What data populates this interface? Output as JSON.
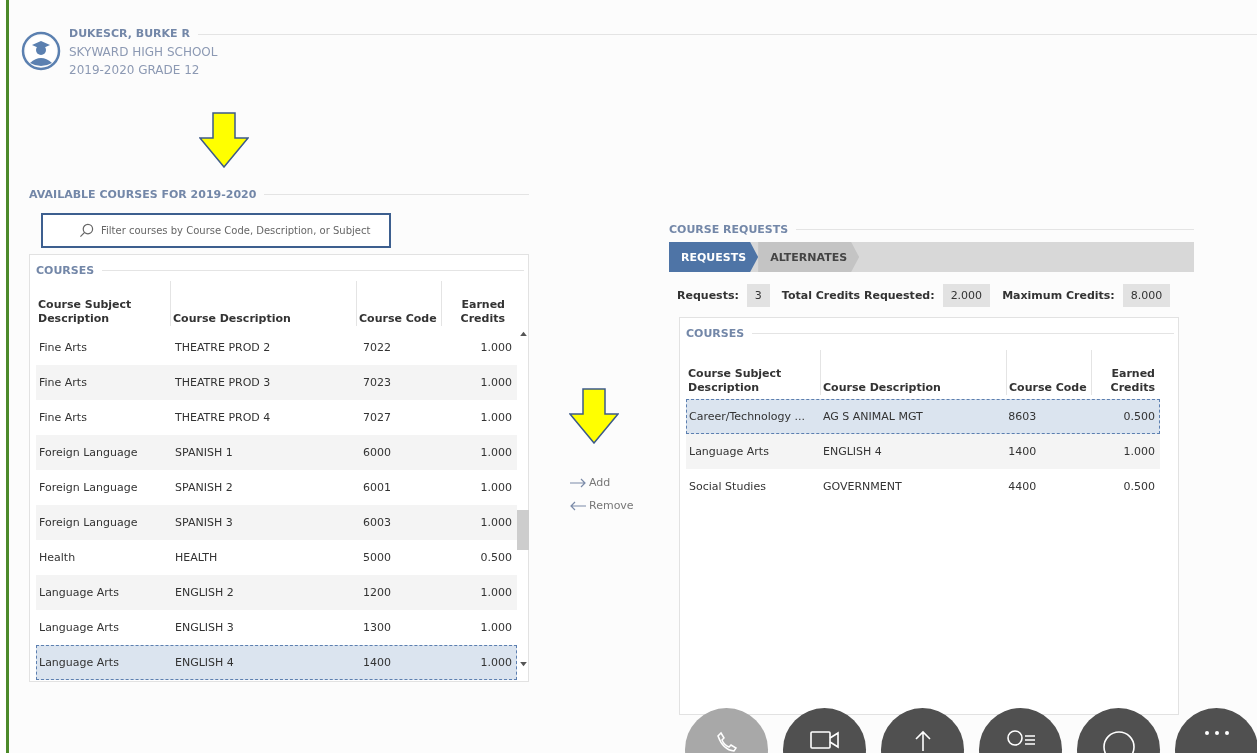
{
  "student": {
    "name": "DUKESCR, BURKE R",
    "school": "SKYWARD HIGH SCHOOL",
    "year_grade": "2019-2020 GRADE 12"
  },
  "available": {
    "title": "AVAILABLE COURSES FOR 2019-2020",
    "search": {
      "placeholder": "Filter courses by Course Code, Description, or Subject"
    },
    "section": "COURSES",
    "columns": [
      "Course Subject Description",
      "Course Description",
      "Course Code",
      "Earned Credits"
    ],
    "rows": [
      {
        "subject": "Fine Arts",
        "description": "THEATRE PROD 2",
        "code": "7022",
        "credits": "1.000",
        "selected": false
      },
      {
        "subject": "Fine Arts",
        "description": "THEATRE PROD 3",
        "code": "7023",
        "credits": "1.000",
        "selected": false
      },
      {
        "subject": "Fine Arts",
        "description": "THEATRE PROD 4",
        "code": "7027",
        "credits": "1.000",
        "selected": false
      },
      {
        "subject": "Foreign Language",
        "description": "SPANISH 1",
        "code": "6000",
        "credits": "1.000",
        "selected": false
      },
      {
        "subject": "Foreign Language",
        "description": "SPANISH 2",
        "code": "6001",
        "credits": "1.000",
        "selected": false
      },
      {
        "subject": "Foreign Language",
        "description": "SPANISH 3",
        "code": "6003",
        "credits": "1.000",
        "selected": false
      },
      {
        "subject": "Health",
        "description": "HEALTH",
        "code": "5000",
        "credits": "0.500",
        "selected": false
      },
      {
        "subject": "Language Arts",
        "description": "ENGLISH 2",
        "code": "1200",
        "credits": "1.000",
        "selected": false
      },
      {
        "subject": "Language Arts",
        "description": "ENGLISH 3",
        "code": "1300",
        "credits": "1.000",
        "selected": false
      },
      {
        "subject": "Language Arts",
        "description": "ENGLISH 4",
        "code": "1400",
        "credits": "1.000",
        "selected": true
      }
    ]
  },
  "actions": {
    "add": "Add",
    "remove": "Remove"
  },
  "requests": {
    "title": "COURSE REQUESTS",
    "tabs": [
      {
        "label": "REQUESTS",
        "selected": true
      },
      {
        "label": "ALTERNATES",
        "selected": false
      }
    ],
    "stats": [
      {
        "label": "Requests:",
        "value": "3"
      },
      {
        "label": "Total Credits Requested:",
        "value": "2.000"
      },
      {
        "label": "Maximum Credits:",
        "value": "8.000"
      }
    ],
    "section": "COURSES",
    "columns": [
      "Course Subject Description",
      "Course Description",
      "Course Code",
      "Earned Credits"
    ],
    "rows": [
      {
        "subject": "Career/Technology ...",
        "description": "AG S ANIMAL MGT",
        "code": "8603",
        "credits": "0.500",
        "selected": true
      },
      {
        "subject": "Language Arts",
        "description": "ENGLISH 4",
        "code": "1400",
        "credits": "1.000",
        "selected": false
      },
      {
        "subject": "Social Studies",
        "description": "GOVERNMENT",
        "code": "4400",
        "credits": "0.500",
        "selected": false
      }
    ]
  },
  "call_controls": [
    {
      "kind": "phone",
      "disabled": true
    },
    {
      "kind": "video",
      "disabled": false
    },
    {
      "kind": "share",
      "disabled": false
    },
    {
      "kind": "participants",
      "disabled": false
    },
    {
      "kind": "chat",
      "disabled": false
    },
    {
      "kind": "more",
      "disabled": false
    }
  ]
}
